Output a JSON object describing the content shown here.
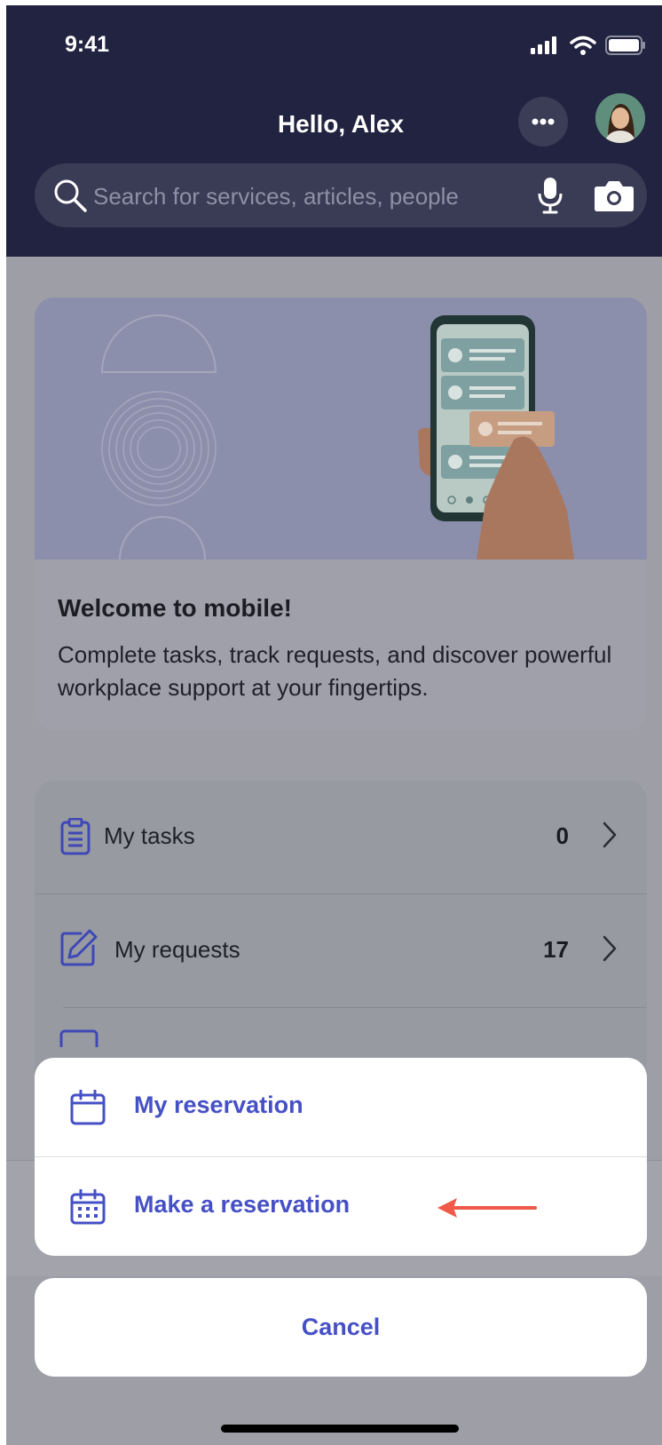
{
  "status_bar": {
    "time": "9:41"
  },
  "header": {
    "greeting": "Hello, Alex",
    "search": {
      "placeholder": "Search for services, articles, people"
    }
  },
  "welcome_card": {
    "title": "Welcome to mobile!",
    "body": "Complete tasks, track requests, and discover powerful workplace support at your fingertips."
  },
  "list": {
    "items": [
      {
        "label": "My tasks",
        "count": "0",
        "icon": "clipboard-icon"
      },
      {
        "label": "My requests",
        "count": "17",
        "icon": "edit-icon"
      }
    ]
  },
  "action_sheet": {
    "items": [
      {
        "label": "My reservation",
        "icon": "calendar-icon"
      },
      {
        "label": "Make a reservation",
        "icon": "calendar-grid-icon"
      }
    ],
    "cancel_label": "Cancel"
  },
  "colors": {
    "header_bg": "#212340",
    "accent": "#4650c6",
    "annotation_arrow": "#f0584a"
  }
}
